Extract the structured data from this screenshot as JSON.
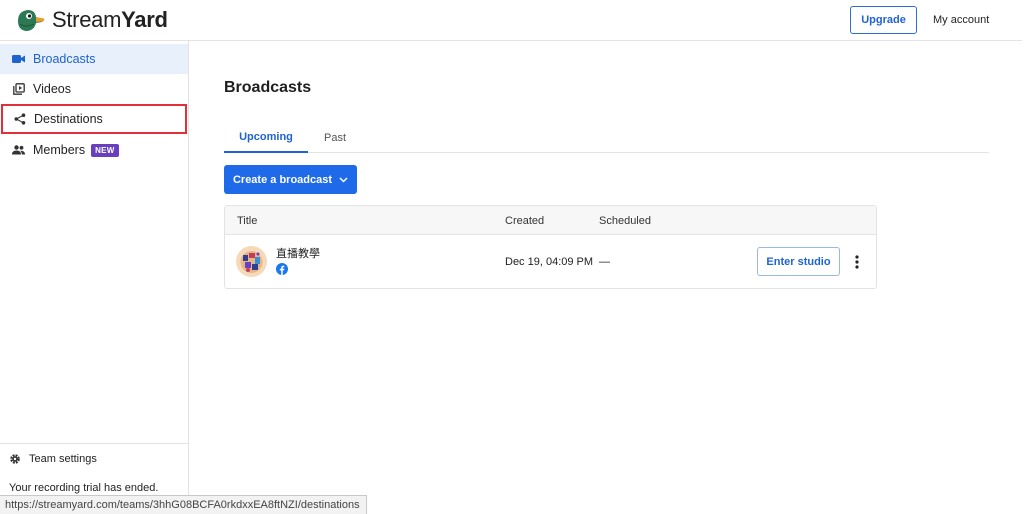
{
  "header": {
    "logo_light": "Stream",
    "logo_bold": "Yard",
    "upgrade_label": "Upgrade",
    "account_label": "My account"
  },
  "sidebar": {
    "items": [
      {
        "label": "Broadcasts",
        "icon": "video-camera-icon",
        "active": true
      },
      {
        "label": "Videos",
        "icon": "video-library-icon"
      },
      {
        "label": "Destinations",
        "icon": "share-icon",
        "highlighted": true
      },
      {
        "label": "Members",
        "icon": "people-icon",
        "badge": "NEW"
      }
    ],
    "team_settings": "Team settings",
    "trial_message": "Your recording trial has ended."
  },
  "main": {
    "title": "Broadcasts",
    "tabs": [
      {
        "label": "Upcoming",
        "active": true
      },
      {
        "label": "Past"
      }
    ],
    "create_button": "Create a broadcast",
    "table": {
      "headers": {
        "title": "Title",
        "created": "Created",
        "scheduled": "Scheduled"
      },
      "rows": [
        {
          "title": "直播教學",
          "platform_icon": "facebook-icon",
          "created": "Dec 19, 04:09 PM",
          "scheduled": "—",
          "action": "Enter studio"
        }
      ]
    }
  },
  "status_bar": {
    "url": "https://streamyard.com/teams/3hhG08BCFA0rkdxxEA8ftNZI/destinations"
  },
  "colors": {
    "accent": "#1f63d1",
    "primary_button": "#1f6ae8",
    "active_nav_bg": "#e8f0fc",
    "highlight_border": "#e0303a",
    "badge_new": "#6a3fbf",
    "facebook": "#1877f2"
  }
}
